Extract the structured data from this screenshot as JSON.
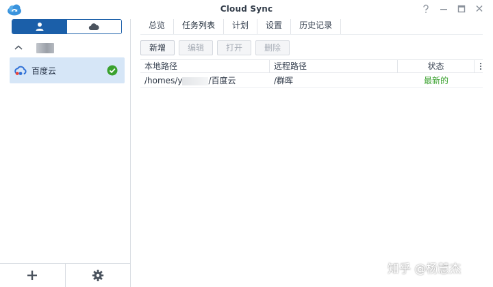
{
  "window": {
    "title": "Cloud Sync",
    "controls": [
      "help-icon",
      "minimize-icon",
      "maximize-icon",
      "close-icon"
    ]
  },
  "sidebar": {
    "segments": [
      {
        "icon": "user-icon",
        "selected": true
      },
      {
        "icon": "cloud-icon",
        "selected": false
      }
    ],
    "account_group": {
      "icon": "chevron-up-icon",
      "name_redacted": true
    },
    "connections": [
      {
        "label": "百度云",
        "icon": "baidu-cloud-icon",
        "status_icon": "check-circle-icon",
        "selected": true
      }
    ],
    "bottom": [
      {
        "icon": "plus-icon"
      },
      {
        "icon": "gear-icon"
      }
    ]
  },
  "tabs": [
    {
      "label": "总览",
      "active": false
    },
    {
      "label": "任务列表",
      "active": true
    },
    {
      "label": "计划",
      "active": false
    },
    {
      "label": "设置",
      "active": false
    },
    {
      "label": "历史记录",
      "active": false
    }
  ],
  "toolbar": {
    "add_label": "新增",
    "edit_label": "编辑",
    "open_label": "打开",
    "delete_label": "删除"
  },
  "table": {
    "columns": [
      "本地路径",
      "远程路径",
      "状态"
    ],
    "rows": [
      {
        "local": "/homes/y",
        "local_suffix": "/百度云",
        "remote": "/群晖",
        "status": "最新的"
      }
    ]
  },
  "watermark": "知乎 @杨慧杰",
  "colors": {
    "accent": "#1b5fa9",
    "selected_row": "#d6e6f7",
    "status_ok": "#3aa12e"
  }
}
